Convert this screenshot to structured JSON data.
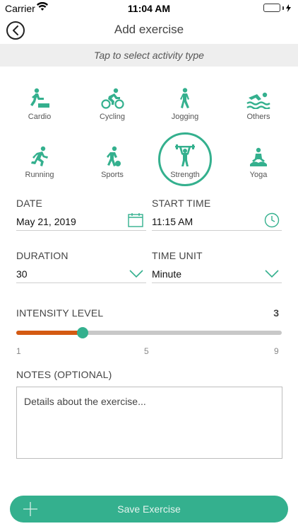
{
  "status_bar": {
    "carrier": "Carrier",
    "time": "11:04 AM",
    "battery_color": "#3ac266"
  },
  "nav": {
    "title": "Add exercise"
  },
  "activity_hint": "Tap to select activity type",
  "activities": [
    {
      "label": "Cardio",
      "icon": "cardio-icon"
    },
    {
      "label": "Cycling",
      "icon": "cycling-icon"
    },
    {
      "label": "Jogging",
      "icon": "jogging-icon"
    },
    {
      "label": "Others",
      "icon": "swimming-icon"
    },
    {
      "label": "Running",
      "icon": "running-icon"
    },
    {
      "label": "Sports",
      "icon": "sports-icon"
    },
    {
      "label": "Strength",
      "icon": "weightlifting-icon",
      "selected": true
    },
    {
      "label": "Yoga",
      "icon": "yoga-icon"
    }
  ],
  "fields": {
    "date": {
      "label": "DATE",
      "value": "May 21, 2019"
    },
    "start_time": {
      "label": "START TIME",
      "value": "11:15 AM"
    },
    "duration": {
      "label": "DURATION",
      "value": "30"
    },
    "time_unit": {
      "label": "TIME UNIT",
      "value": "Minute"
    }
  },
  "intensity": {
    "label": "INTENSITY LEVEL",
    "value": "3",
    "min": 1,
    "max": 9,
    "ticks": [
      "1",
      "5",
      "9"
    ]
  },
  "notes": {
    "label": "NOTES (OPTIONAL)",
    "placeholder": "Details about the exercise..."
  },
  "save_button": {
    "label": "Save Exercise"
  },
  "colors": {
    "accent": "#34b08e",
    "slider_fill": "#d45a12",
    "hint_bg": "#eeeeee"
  }
}
